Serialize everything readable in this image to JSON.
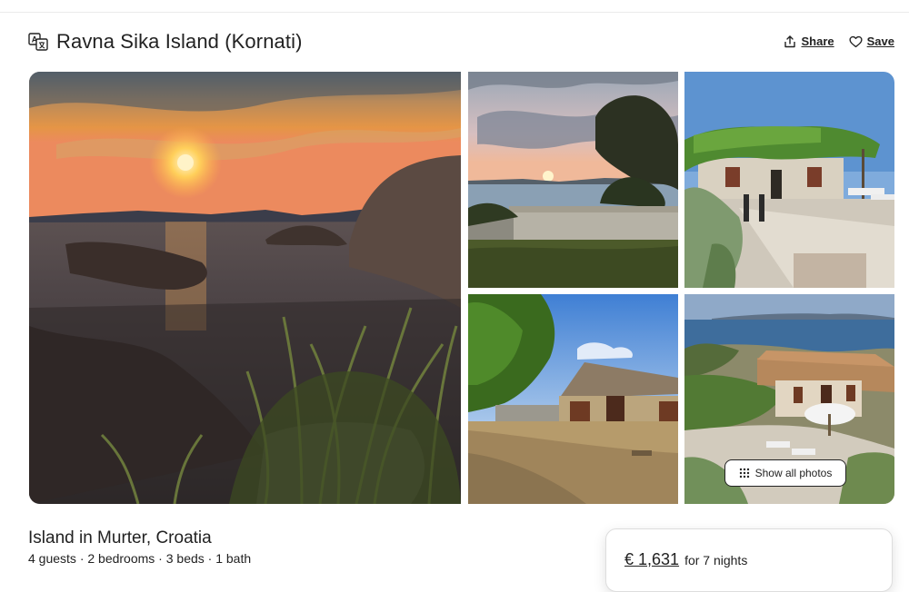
{
  "header": {
    "title": "Ravna Sika Island (Kornati)",
    "translate_icon": "translate-icon",
    "share_label": "Share",
    "save_label": "Save",
    "share_icon": "share-icon",
    "save_icon": "heart-icon"
  },
  "gallery": {
    "show_all_label": "Show all photos",
    "show_all_icon": "grid-icon",
    "photos": [
      "sunset over the sea with rocky shore",
      "sunset behind a stone wall and tree",
      "stone house with vine-covered pergola",
      "stone cottage under blue sky",
      "aerial view of stone house by the sea"
    ]
  },
  "listing": {
    "type": "Island in Murter, Croatia",
    "details": "4 guests · 2 bedrooms · 3 beds · 1 bath"
  },
  "booking": {
    "price": "€ 1,631",
    "suffix": "for 7 nights"
  },
  "colors": {
    "text": "#222222",
    "border": "#dddddd"
  }
}
